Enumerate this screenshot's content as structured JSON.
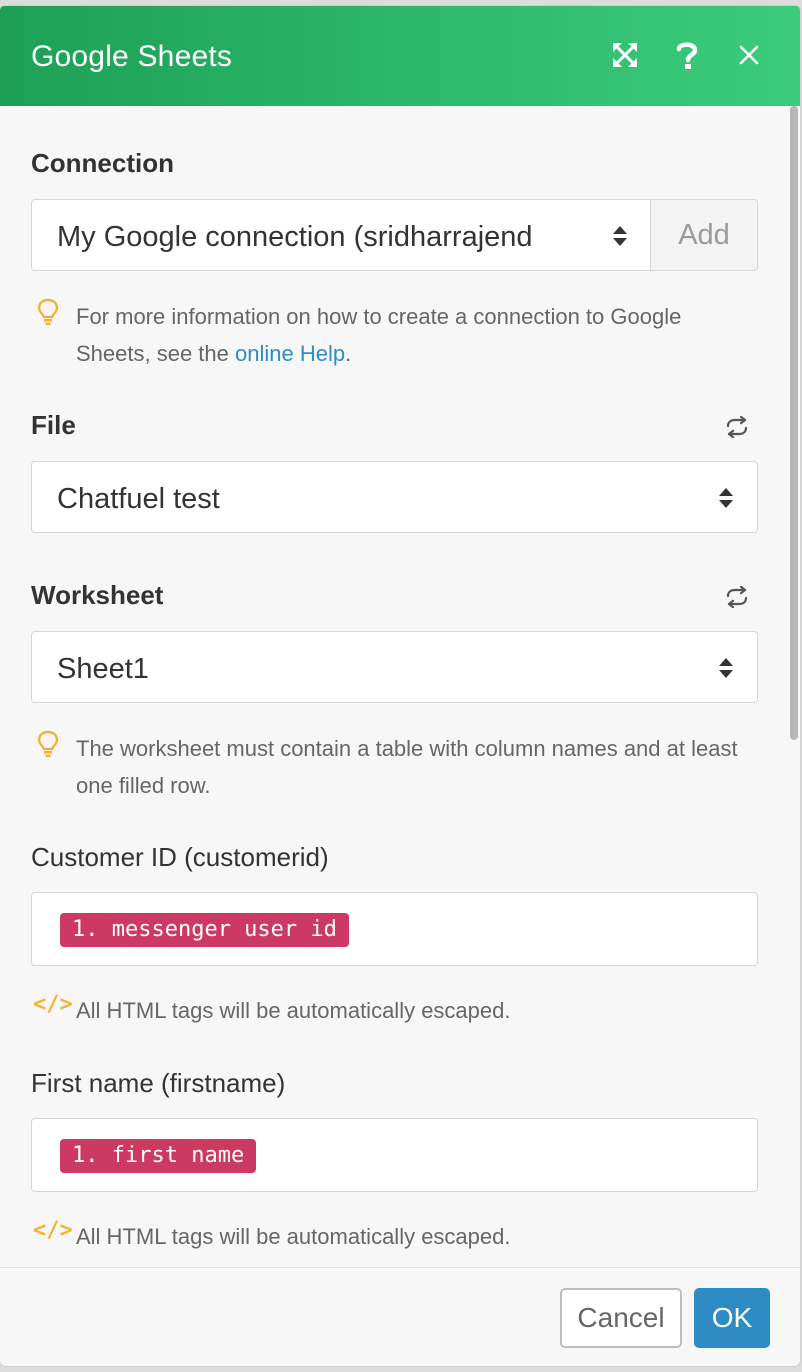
{
  "dialog": {
    "title": "Google Sheets",
    "icons": {
      "expand": "expand-icon",
      "help": "help-icon",
      "close": "close-icon"
    }
  },
  "connection": {
    "label": "Connection",
    "value": "My Google connection (sridharrajend",
    "add_label": "Add",
    "hint_prefix": "For more information on how to create a connection to Google Sheets, see the ",
    "hint_link": "online Help",
    "hint_suffix": "."
  },
  "file": {
    "label": "File",
    "value": "Chatfuel test"
  },
  "worksheet": {
    "label": "Worksheet",
    "value": "Sheet1",
    "hint": "The worksheet must contain a table with column names and at least one filled row."
  },
  "fields": [
    {
      "label": "Customer ID (customerid)",
      "token": "1. messenger user id",
      "hint": "All HTML tags will be automatically escaped."
    },
    {
      "label": "First name (firstname)",
      "token": "1. first name",
      "hint": "All HTML tags will be automatically escaped."
    }
  ],
  "footer": {
    "cancel_label": "Cancel",
    "ok_label": "OK"
  },
  "colors": {
    "header_start": "#1da056",
    "header_end": "#3ccb7c",
    "token_bg": "#cc3a63",
    "link": "#2b8fc7",
    "ok_button": "#2e8bc3",
    "hint_icon": "#f1b434"
  }
}
